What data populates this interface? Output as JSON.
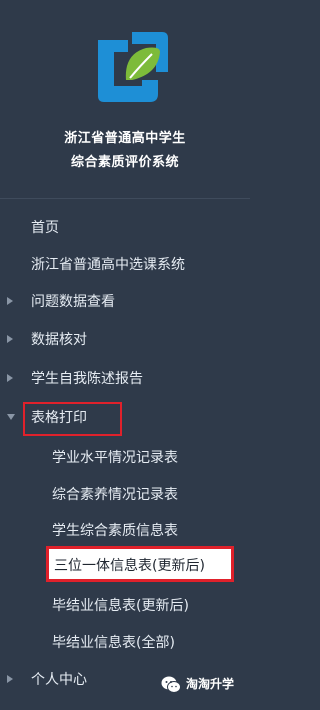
{
  "app": {
    "title_line1": "浙江省普通高中学生",
    "title_line2": "综合素质评价系统"
  },
  "nav": {
    "home": "首页",
    "course_selection": "浙江省普通高中选课系统",
    "issue_data": "问题数据查看",
    "data_check": "数据核对",
    "self_report": "学生自我陈述报告",
    "form_print": "表格打印",
    "form_print_children": [
      "学业水平情况记录表",
      "综合素养情况记录表",
      "学生综合素质信息表",
      "三位一体信息表(更新后)",
      "毕结业信息表(更新后)",
      "毕结业信息表(全部)"
    ],
    "personal_center": "个人中心"
  },
  "watermark": {
    "text": "淘淘升学"
  },
  "colors": {
    "sidebar_bg": "#2f3a4a",
    "highlight_red": "#e0212b",
    "logo_blue": "#1e8fd6",
    "logo_green": "#7dbb3a"
  },
  "icons": {
    "collapsed_arrow": "caret-right-icon",
    "expanded_arrow": "caret-down-icon",
    "logo": "leaf-logo-icon",
    "watermark": "wechat-icon"
  }
}
